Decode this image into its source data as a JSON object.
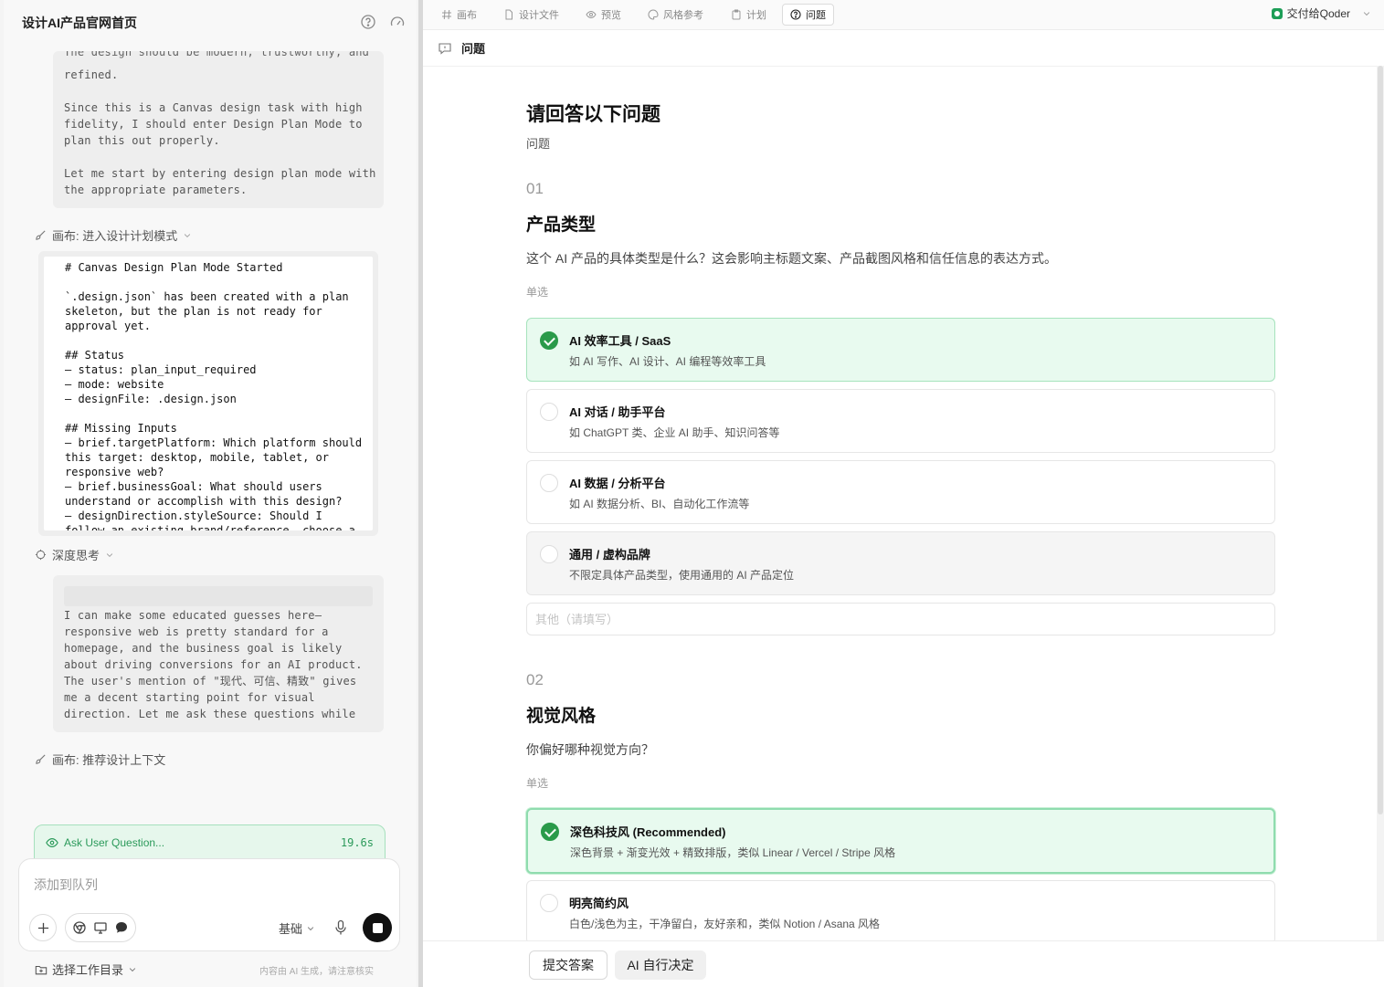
{
  "left_panel": {
    "title": "设计AI产品官网首页",
    "thinking_1": "refined.\n\nSince this is a Canvas design task with high\nfidelity, I should enter Design Plan Mode to\nplan this out properly.\n\nLet me start by entering design plan mode with\nthe appropriate parameters.",
    "thinking_1_cut": "The design should be modern, trustworthy, and",
    "tool_call_1": "画布: 进入设计计划模式",
    "tool_result": "# Canvas Design Plan Mode Started\n\n`.design.json` has been created with a plan\nskeleton, but the plan is not ready for\napproval yet.\n\n## Status\n– status: plan_input_required\n– mode: website\n– designFile: .design.json\n\n## Missing Inputs\n– brief.targetPlatform: Which platform should\nthis target: desktop, mobile, tablet, or\nresponsive web?\n– brief.businessGoal: What should users\nunderstand or accomplish with this design?\n– designDirection.styleSource: Should I\nfollow an existing brand/reference, choose a",
    "deep_think_label": "深度思考",
    "thinking_2": "I can make some educated guesses here—\nresponsive web is pretty standard for a\nhomepage, and the business goal is likely\nabout driving conversions for an AI product.\nThe user's mention of \"现代、可信、精致\" gives\nme a decent starting point for visual\ndirection. Let me ask these questions while",
    "tool_call_2": "画布: 推荐设计上下文",
    "status": {
      "label": "Ask User Question...",
      "time": "19.6s"
    },
    "input_placeholder": "添加到队列",
    "mode": "基础",
    "workdir": "选择工作目录",
    "disclaimer": "内容由 AI 生成，请注意核实"
  },
  "tabs": [
    {
      "label": "画布",
      "icon": "hash-icon"
    },
    {
      "label": "设计文件",
      "icon": "file-icon"
    },
    {
      "label": "预览",
      "icon": "eye-icon"
    },
    {
      "label": "风格参考",
      "icon": "palette-icon"
    },
    {
      "label": "计划",
      "icon": "clipboard-icon"
    },
    {
      "label": "问题",
      "icon": "question-icon",
      "active": true
    }
  ],
  "deliver_label": "交付给Qoder",
  "breadcrumb": "问题",
  "form": {
    "title": "请回答以下问题",
    "subtitle": "问题",
    "questions": [
      {
        "number": "01",
        "heading": "产品类型",
        "description": "这个 AI 产品的具体类型是什么？这会影响主标题文案、产品截图风格和信任信息的表达方式。",
        "type": "单选",
        "options": [
          {
            "title": "AI 效率工具 / SaaS",
            "desc": "如 AI 写作、AI 设计、AI 编程等效率工具",
            "selected": true
          },
          {
            "title": "AI 对话 / 助手平台",
            "desc": "如 ChatGPT 类、企业 AI 助手、知识问答等",
            "selected": false
          },
          {
            "title": "AI 数据 / 分析平台",
            "desc": "如 AI 数据分析、BI、自动化工作流等",
            "selected": false
          },
          {
            "title": "通用 / 虚构品牌",
            "desc": "不限定具体产品类型，使用通用的 AI 产品定位",
            "selected": false
          }
        ],
        "other_placeholder": "其他（请填写）"
      },
      {
        "number": "02",
        "heading": "视觉风格",
        "description": "你偏好哪种视觉方向？",
        "type": "单选",
        "options": [
          {
            "title": "深色科技风 (Recommended)",
            "desc": "深色背景 + 渐变光效 + 精致排版，类似 Linear / Vercel / Stripe 风格",
            "selected": true
          },
          {
            "title": "明亮简约风",
            "desc": "白色/浅色为主，干净留白，友好亲和，类似 Notion / Asana 风格",
            "selected": false
          }
        ]
      }
    ]
  },
  "footer": {
    "submit": "提交答案",
    "ai_decide": "AI 自行决定"
  },
  "colors": {
    "accent_green": "#2a9a4a",
    "selected_bg": "#e8faef",
    "status_green": "#2b9a5a"
  }
}
